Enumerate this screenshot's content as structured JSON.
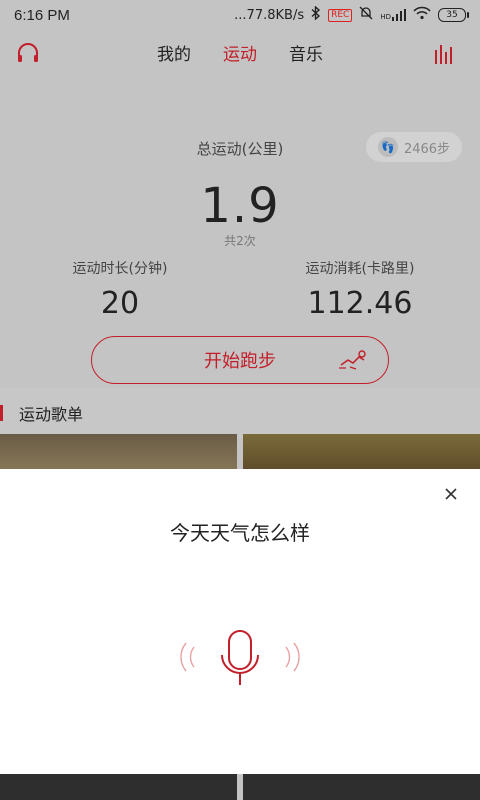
{
  "status_bar": {
    "time": "6:16 PM",
    "network_speed": "...77.8KB/s",
    "bluetooth_icon": "bluetooth-icon",
    "record_badge": "REC",
    "hd_label": "HD",
    "battery": "35"
  },
  "top_nav": {
    "tabs": [
      {
        "label": "我的",
        "active": false
      },
      {
        "label": "运动",
        "active": true
      },
      {
        "label": "音乐",
        "active": false
      }
    ],
    "left_icon": "headphones-icon",
    "right_icon": "equalizer-icon"
  },
  "summary": {
    "title": "总运动(公里)",
    "total_km": "1.9",
    "times": "共2次",
    "steps": "2466步",
    "duration_label": "运动时长(分钟)",
    "duration_value": "20",
    "calories_label": "运动消耗(卡路里)",
    "calories_value": "112.46",
    "run_button": "开始跑步"
  },
  "playlist": {
    "title": "运动歌单"
  },
  "voice_sheet": {
    "prompt": "今天天气怎么样",
    "close_icon": "close-icon",
    "mic_icon": "microphone-icon"
  },
  "colors": {
    "accent": "#c21f2a",
    "overlay_bg": "#c4c4c4",
    "sheet_bg": "#ffffff"
  }
}
